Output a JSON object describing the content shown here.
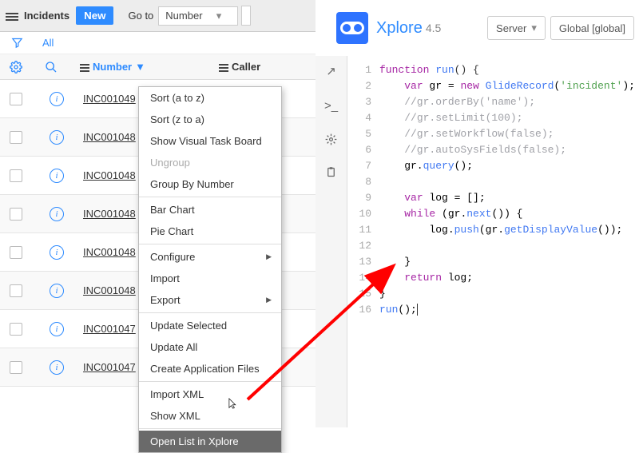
{
  "leftHeader": {
    "title": "Incidents",
    "newButton": "New",
    "gotoLabel": "Go to",
    "gotoSelect": "Number"
  },
  "filter": {
    "allLabel": "All"
  },
  "columns": {
    "number": "Number",
    "caller": "Caller"
  },
  "rows": [
    "INC001049",
    "INC001048",
    "INC001048",
    "INC001048",
    "INC001048",
    "INC001048",
    "INC001047",
    "INC001047"
  ],
  "contextMenu": [
    {
      "label": "Sort (a to z)"
    },
    {
      "label": "Sort (z to a)"
    },
    {
      "label": "Show Visual Task Board"
    },
    {
      "label": "Ungroup",
      "disabled": true
    },
    {
      "label": "Group By Number"
    },
    {
      "sep": true
    },
    {
      "label": "Bar Chart"
    },
    {
      "label": "Pie Chart"
    },
    {
      "sep": true
    },
    {
      "label": "Configure",
      "submenu": true
    },
    {
      "label": "Import"
    },
    {
      "label": "Export",
      "submenu": true
    },
    {
      "sep": true
    },
    {
      "label": "Update Selected"
    },
    {
      "label": "Update All"
    },
    {
      "label": "Create Application Files"
    },
    {
      "sep": true
    },
    {
      "label": "Import XML"
    },
    {
      "label": "Show XML"
    },
    {
      "sep": true
    },
    {
      "label": "Open List in Xplore",
      "highlight": true
    }
  ],
  "xplore": {
    "title": "Xplore",
    "version": "4.5",
    "serverSelect": "Server",
    "globalSelect": "Global [global]"
  },
  "code": {
    "lines": 16,
    "line1_a": "function",
    "line1_b": " run",
    "line1_c": "() {",
    "line2_a": "    ",
    "line2_kw": "var",
    "line2_b": " gr = ",
    "line2_new": "new",
    "line2_c": " ",
    "line2_fn": "GlideRecord",
    "line2_d": "(",
    "line2_str": "'incident'",
    "line2_e": ");",
    "line3": "    //gr.orderBy('name');",
    "line4_a": "    ",
    "line4_c": "//gr.setLimit(100);",
    "line5": "    //gr.setWorkflow(false);",
    "line6": "    //gr.autoSysFields(false);",
    "line7_a": "    gr.",
    "line7_fn": "query",
    "line7_b": "();",
    "line8": "",
    "line9_a": "    ",
    "line9_kw": "var",
    "line9_b": " log = [];",
    "line10_a": "    ",
    "line10_kw": "while",
    "line10_b": " (gr.",
    "line10_fn": "next",
    "line10_c": "()) {",
    "line11_a": "        log.",
    "line11_fn": "push",
    "line11_b": "(gr.",
    "line11_fn2": "getDisplayValue",
    "line11_c": "());",
    "line12": "",
    "line13": "    }",
    "line14_a": "    ",
    "line14_kw": "return",
    "line14_b": " log;",
    "line15": "}",
    "line16_a": "run",
    "line16_b": "();"
  }
}
